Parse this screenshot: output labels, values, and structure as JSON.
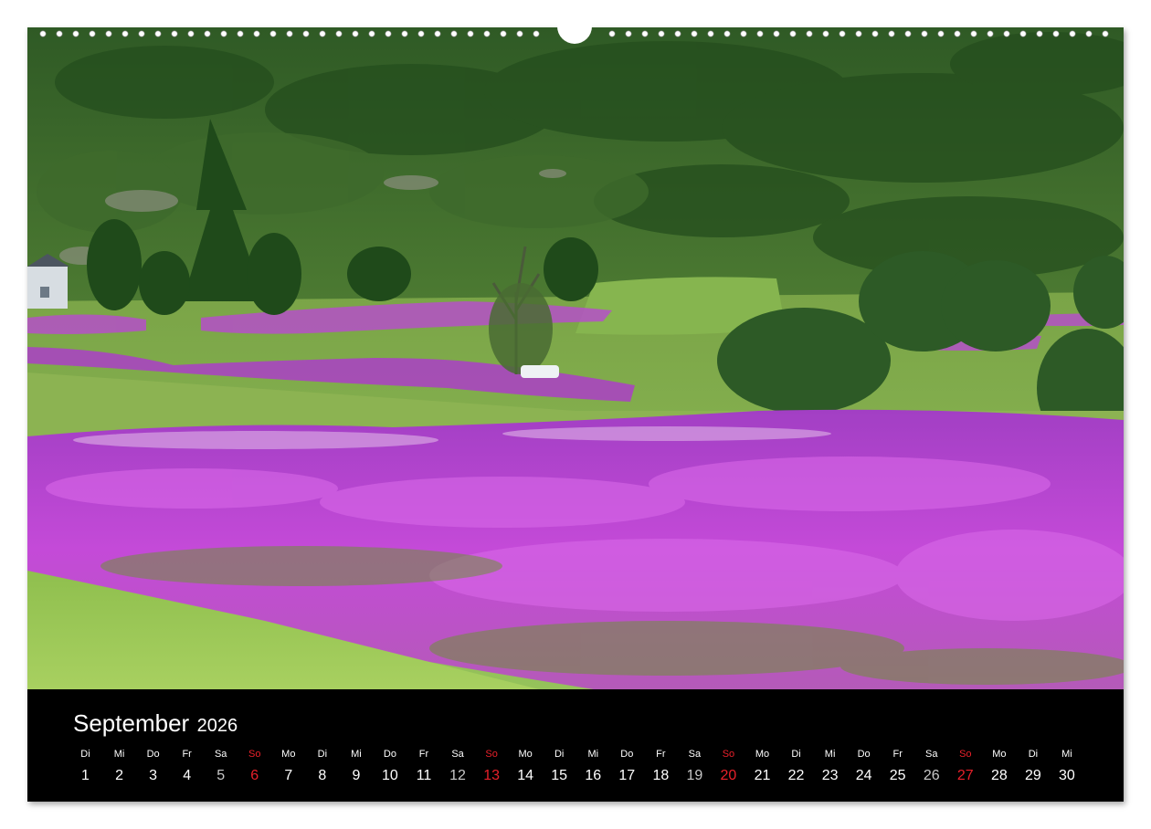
{
  "calendar": {
    "month": "September",
    "year": "2026",
    "days": [
      {
        "dow": "Di",
        "num": "1",
        "type": "weekday"
      },
      {
        "dow": "Mi",
        "num": "2",
        "type": "weekday"
      },
      {
        "dow": "Do",
        "num": "3",
        "type": "weekday"
      },
      {
        "dow": "Fr",
        "num": "4",
        "type": "weekday"
      },
      {
        "dow": "Sa",
        "num": "5",
        "type": "saturday"
      },
      {
        "dow": "So",
        "num": "6",
        "type": "sunday"
      },
      {
        "dow": "Mo",
        "num": "7",
        "type": "weekday"
      },
      {
        "dow": "Di",
        "num": "8",
        "type": "weekday"
      },
      {
        "dow": "Mi",
        "num": "9",
        "type": "weekday"
      },
      {
        "dow": "Do",
        "num": "10",
        "type": "weekday"
      },
      {
        "dow": "Fr",
        "num": "11",
        "type": "weekday"
      },
      {
        "dow": "Sa",
        "num": "12",
        "type": "saturday"
      },
      {
        "dow": "So",
        "num": "13",
        "type": "sunday"
      },
      {
        "dow": "Mo",
        "num": "14",
        "type": "weekday"
      },
      {
        "dow": "Di",
        "num": "15",
        "type": "weekday"
      },
      {
        "dow": "Mi",
        "num": "16",
        "type": "weekday"
      },
      {
        "dow": "Do",
        "num": "17",
        "type": "weekday"
      },
      {
        "dow": "Fr",
        "num": "18",
        "type": "weekday"
      },
      {
        "dow": "Sa",
        "num": "19",
        "type": "saturday"
      },
      {
        "dow": "So",
        "num": "20",
        "type": "sunday"
      },
      {
        "dow": "Mo",
        "num": "21",
        "type": "weekday"
      },
      {
        "dow": "Di",
        "num": "22",
        "type": "weekday"
      },
      {
        "dow": "Mi",
        "num": "23",
        "type": "weekday"
      },
      {
        "dow": "Do",
        "num": "24",
        "type": "weekday"
      },
      {
        "dow": "Fr",
        "num": "25",
        "type": "weekday"
      },
      {
        "dow": "Sa",
        "num": "26",
        "type": "saturday"
      },
      {
        "dow": "So",
        "num": "27",
        "type": "sunday"
      },
      {
        "dow": "Mo",
        "num": "28",
        "type": "weekday"
      },
      {
        "dow": "Di",
        "num": "29",
        "type": "weekday"
      },
      {
        "dow": "Mi",
        "num": "30",
        "type": "weekday"
      }
    ]
  },
  "colors": {
    "sunday": "#e8202a",
    "saturday": "#c8c8c8",
    "weekday": "#ffffff",
    "background": "#000000",
    "fireweed": "#c040d0"
  },
  "icons": {
    "binding": "spiral-binding-icon",
    "hanger": "hanger-notch-icon"
  }
}
